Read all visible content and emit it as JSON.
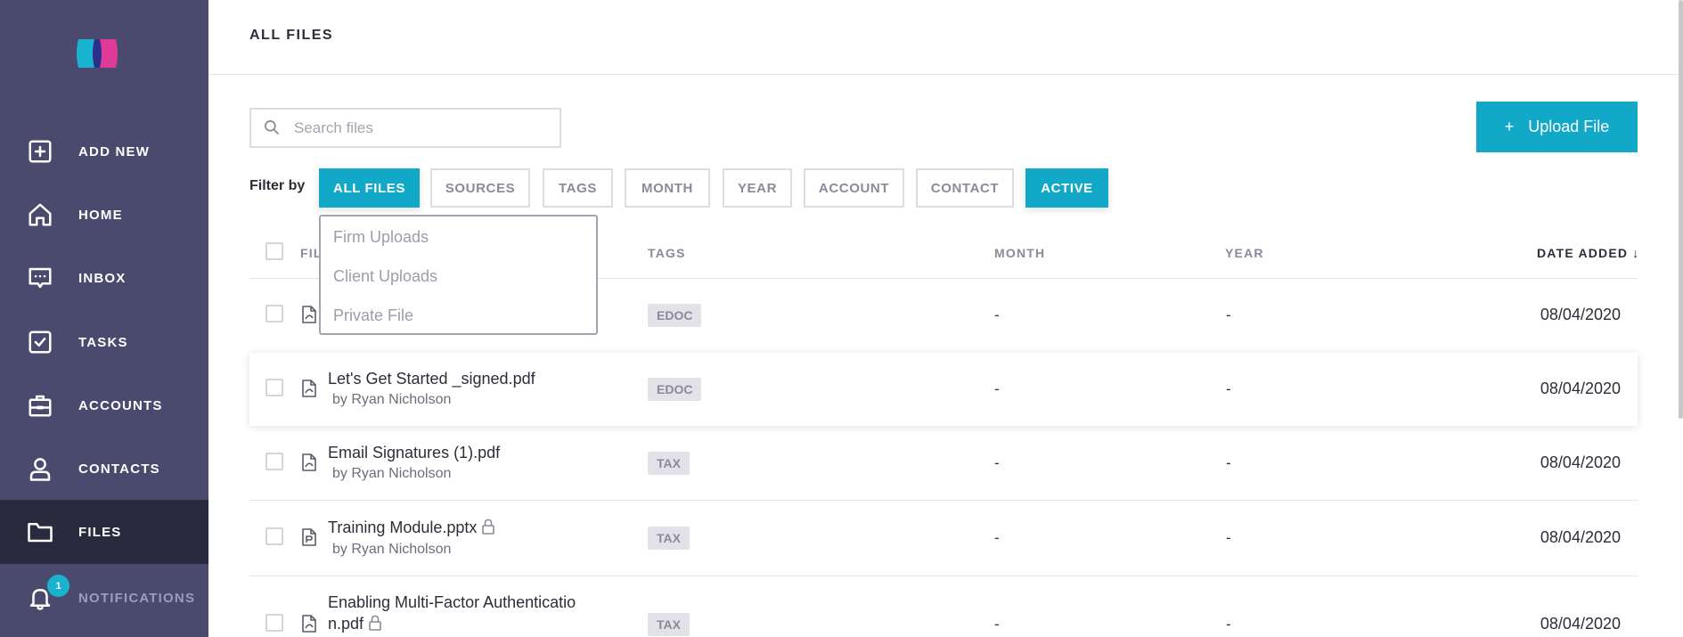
{
  "sidebar": {
    "logo_name": "app-logo",
    "items": [
      {
        "label": "ADD NEW",
        "icon": "plus-square-icon"
      },
      {
        "label": "HOME",
        "icon": "home-icon"
      },
      {
        "label": "INBOX",
        "icon": "message-icon"
      },
      {
        "label": "TASKS",
        "icon": "check-square-icon"
      },
      {
        "label": "ACCOUNTS",
        "icon": "briefcase-icon"
      },
      {
        "label": "CONTACTS",
        "icon": "user-icon"
      },
      {
        "label": "FILES",
        "icon": "folder-icon",
        "active": true
      },
      {
        "label": "NOTIFICATIONS",
        "icon": "bell-icon",
        "badge": "1"
      }
    ]
  },
  "header": {
    "title": "ALL FILES"
  },
  "search": {
    "placeholder": "Search files",
    "value": ""
  },
  "upload": {
    "plus": "+",
    "label": "Upload File"
  },
  "filter": {
    "label": "Filter by",
    "chips": [
      "ALL FILES",
      "SOURCES",
      "TAGS",
      "MONTH",
      "YEAR",
      "ACCOUNT",
      "CONTACT",
      "ACTIVE"
    ],
    "active": [
      "ALL FILES",
      "ACTIVE"
    ]
  },
  "dropdown": {
    "items": [
      "Firm Uploads",
      "Client Uploads",
      "Private File"
    ]
  },
  "table": {
    "headers": {
      "file": "FIL",
      "tags": "TAGS",
      "month": "MONTH",
      "year": "YEAR",
      "date": "DATE ADDED ↓"
    },
    "rows": [
      {
        "name": "",
        "by": "",
        "tag": "EDOC",
        "month": "-",
        "year": "-",
        "date": "08/04/2020",
        "icon": "pdf-file-icon"
      },
      {
        "name": "Let's Get Started _signed.pdf",
        "by": "by Ryan Nicholson",
        "tag": "EDOC",
        "month": "-",
        "year": "-",
        "date": "08/04/2020",
        "icon": "pdf-file-icon"
      },
      {
        "name": "Email Signatures (1).pdf",
        "by": "by Ryan Nicholson",
        "tag": "TAX",
        "month": "-",
        "year": "-",
        "date": "08/04/2020",
        "icon": "pdf-file-icon"
      },
      {
        "name": "Training Module.pptx",
        "by": "by Ryan Nicholson",
        "tag": "TAX",
        "month": "-",
        "year": "-",
        "date": "08/04/2020",
        "icon": "pptx-file-icon",
        "locked": true
      },
      {
        "name_line1": "Enabling Multi-Factor Authenticatio",
        "name_line2": "n.pdf",
        "tag": "TAX",
        "month": "-",
        "year": "-",
        "date": "08/04/2020",
        "icon": "pdf-file-icon",
        "locked": true
      }
    ]
  },
  "colors": {
    "sidebar": "#4a4a6e",
    "sidebar_active": "#2a2a3e",
    "accent": "#12a9c8",
    "badge": "#1ab3cf"
  }
}
